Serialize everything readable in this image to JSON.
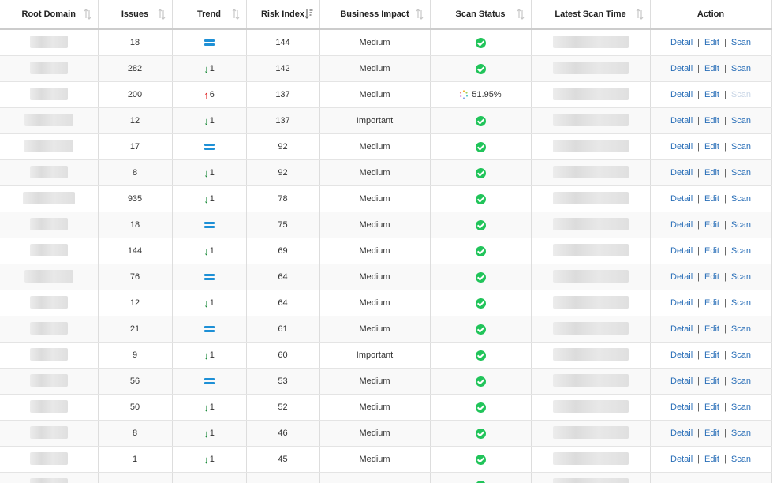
{
  "columns": [
    {
      "key": "root_domain",
      "label": "Root Domain"
    },
    {
      "key": "issues",
      "label": "Issues"
    },
    {
      "key": "trend",
      "label": "Trend"
    },
    {
      "key": "risk_index",
      "label": "Risk Index"
    },
    {
      "key": "business_impact",
      "label": "Business Impact"
    },
    {
      "key": "scan_status",
      "label": "Scan Status"
    },
    {
      "key": "latest_scan_time",
      "label": "Latest Scan Time"
    },
    {
      "key": "action",
      "label": "Action"
    }
  ],
  "actions": {
    "detail": "Detail",
    "edit": "Edit",
    "scan": "Scan",
    "separator": "|"
  },
  "colors": {
    "link": "#2a6fb8",
    "trend_down": "#1a8a3a",
    "trend_up": "#e02020",
    "trend_equal": "#1e90d6",
    "status_ok": "#21c45a"
  },
  "rows": [
    {
      "issues": "18",
      "trend": "equal",
      "trend_value": "",
      "risk_index": "144",
      "business_impact": "Medium",
      "scan_status": "done",
      "progress": ""
    },
    {
      "issues": "282",
      "trend": "down",
      "trend_value": "1",
      "risk_index": "142",
      "business_impact": "Medium",
      "scan_status": "done",
      "progress": ""
    },
    {
      "issues": "200",
      "trend": "up",
      "trend_value": "6",
      "risk_index": "137",
      "business_impact": "Medium",
      "scan_status": "scanning",
      "progress": "51.95%"
    },
    {
      "issues": "12",
      "trend": "down",
      "trend_value": "1",
      "risk_index": "137",
      "business_impact": "Important",
      "scan_status": "done",
      "progress": ""
    },
    {
      "issues": "17",
      "trend": "equal",
      "trend_value": "",
      "risk_index": "92",
      "business_impact": "Medium",
      "scan_status": "done",
      "progress": ""
    },
    {
      "issues": "8",
      "trend": "down",
      "trend_value": "1",
      "risk_index": "92",
      "business_impact": "Medium",
      "scan_status": "done",
      "progress": ""
    },
    {
      "issues": "935",
      "trend": "down",
      "trend_value": "1",
      "risk_index": "78",
      "business_impact": "Medium",
      "scan_status": "done",
      "progress": ""
    },
    {
      "issues": "18",
      "trend": "equal",
      "trend_value": "",
      "risk_index": "75",
      "business_impact": "Medium",
      "scan_status": "done",
      "progress": ""
    },
    {
      "issues": "144",
      "trend": "down",
      "trend_value": "1",
      "risk_index": "69",
      "business_impact": "Medium",
      "scan_status": "done",
      "progress": ""
    },
    {
      "issues": "76",
      "trend": "equal",
      "trend_value": "",
      "risk_index": "64",
      "business_impact": "Medium",
      "scan_status": "done",
      "progress": ""
    },
    {
      "issues": "12",
      "trend": "down",
      "trend_value": "1",
      "risk_index": "64",
      "business_impact": "Medium",
      "scan_status": "done",
      "progress": ""
    },
    {
      "issues": "21",
      "trend": "equal",
      "trend_value": "",
      "risk_index": "61",
      "business_impact": "Medium",
      "scan_status": "done",
      "progress": ""
    },
    {
      "issues": "9",
      "trend": "down",
      "trend_value": "1",
      "risk_index": "60",
      "business_impact": "Important",
      "scan_status": "done",
      "progress": ""
    },
    {
      "issues": "56",
      "trend": "equal",
      "trend_value": "",
      "risk_index": "53",
      "business_impact": "Medium",
      "scan_status": "done",
      "progress": ""
    },
    {
      "issues": "50",
      "trend": "down",
      "trend_value": "1",
      "risk_index": "52",
      "business_impact": "Medium",
      "scan_status": "done",
      "progress": ""
    },
    {
      "issues": "8",
      "trend": "down",
      "trend_value": "1",
      "risk_index": "46",
      "business_impact": "Medium",
      "scan_status": "done",
      "progress": ""
    },
    {
      "issues": "1",
      "trend": "down",
      "trend_value": "1",
      "risk_index": "45",
      "business_impact": "Medium",
      "scan_status": "done",
      "progress": ""
    },
    {
      "issues": "",
      "trend": "",
      "trend_value": "",
      "risk_index": "",
      "business_impact": "",
      "scan_status": "done",
      "progress": ""
    }
  ]
}
